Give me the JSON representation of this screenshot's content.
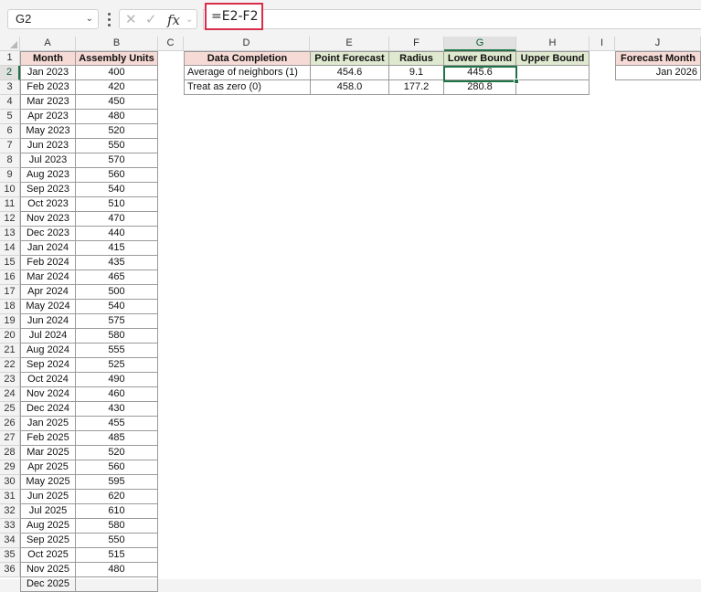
{
  "name_box": "G2",
  "formula": "=E2-F2",
  "formula_icons": {
    "cancel": "cancel-icon",
    "enter": "enter-icon",
    "function": "fx-icon"
  },
  "columns": [
    "A",
    "B",
    "C",
    "D",
    "E",
    "F",
    "G",
    "H",
    "I",
    "J"
  ],
  "selected_cell": {
    "column": "G",
    "row": 2
  },
  "row_numbers": [
    "1",
    "2",
    "3",
    "4",
    "5",
    "6",
    "7",
    "8",
    "9",
    "10",
    "11",
    "12",
    "13",
    "14",
    "15",
    "16",
    "17",
    "18",
    "19",
    "20",
    "21",
    "22",
    "23",
    "24",
    "25",
    "26",
    "27",
    "28",
    "29",
    "30",
    "31",
    "32",
    "33",
    "34",
    "35",
    "36"
  ],
  "data_table": {
    "headers": [
      "Month",
      "Assembly Units"
    ],
    "rows": [
      [
        "Jan 2023",
        "400"
      ],
      [
        "Feb 2023",
        "420"
      ],
      [
        "Mar 2023",
        "450"
      ],
      [
        "Apr 2023",
        "480"
      ],
      [
        "May 2023",
        "520"
      ],
      [
        "Jun 2023",
        "550"
      ],
      [
        "Jul 2023",
        "570"
      ],
      [
        "Aug 2023",
        "560"
      ],
      [
        "Sep 2023",
        "540"
      ],
      [
        "Oct 2023",
        "510"
      ],
      [
        "Nov 2023",
        "470"
      ],
      [
        "Dec 2023",
        "440"
      ],
      [
        "Jan 2024",
        "415"
      ],
      [
        "Feb 2024",
        "435"
      ],
      [
        "Mar 2024",
        "465"
      ],
      [
        "Apr 2024",
        "500"
      ],
      [
        "May 2024",
        "540"
      ],
      [
        "Jun 2024",
        "575"
      ],
      [
        "Jul 2024",
        "580"
      ],
      [
        "Aug 2024",
        "555"
      ],
      [
        "Sep 2024",
        "525"
      ],
      [
        "Oct 2024",
        "490"
      ],
      [
        "Nov 2024",
        "460"
      ],
      [
        "Dec 2024",
        "430"
      ],
      [
        "Jan 2025",
        "455"
      ],
      [
        "Feb 2025",
        "485"
      ],
      [
        "Mar 2025",
        "520"
      ],
      [
        "Apr 2025",
        "560"
      ],
      [
        "May 2025",
        "595"
      ],
      [
        "Jun 2025",
        "620"
      ],
      [
        "Jul 2025",
        "610"
      ],
      [
        "Aug 2025",
        "580"
      ],
      [
        "Sep 2025",
        "550"
      ],
      [
        "Oct 2025",
        "515"
      ],
      [
        "Nov 2025",
        "480"
      ],
      [
        "Dec 2025",
        ""
      ]
    ]
  },
  "completion_table": {
    "headers": [
      "Data Completion",
      "Point Forecast",
      "Radius",
      "Lower Bound",
      "Upper Bound"
    ],
    "rows": [
      [
        "Average of neighbors (1)",
        "454.6",
        "9.1",
        "445.6",
        ""
      ],
      [
        "Treat as zero (0)",
        "458.0",
        "177.2",
        "280.8",
        ""
      ]
    ]
  },
  "forecast": {
    "header": "Forecast Month",
    "value": "Jan 2026"
  },
  "colors": {
    "header_pink": "#f6dad5",
    "header_green": "#dfe9cf",
    "selection": "#217346",
    "formula_highlight": "#d92d4a"
  }
}
